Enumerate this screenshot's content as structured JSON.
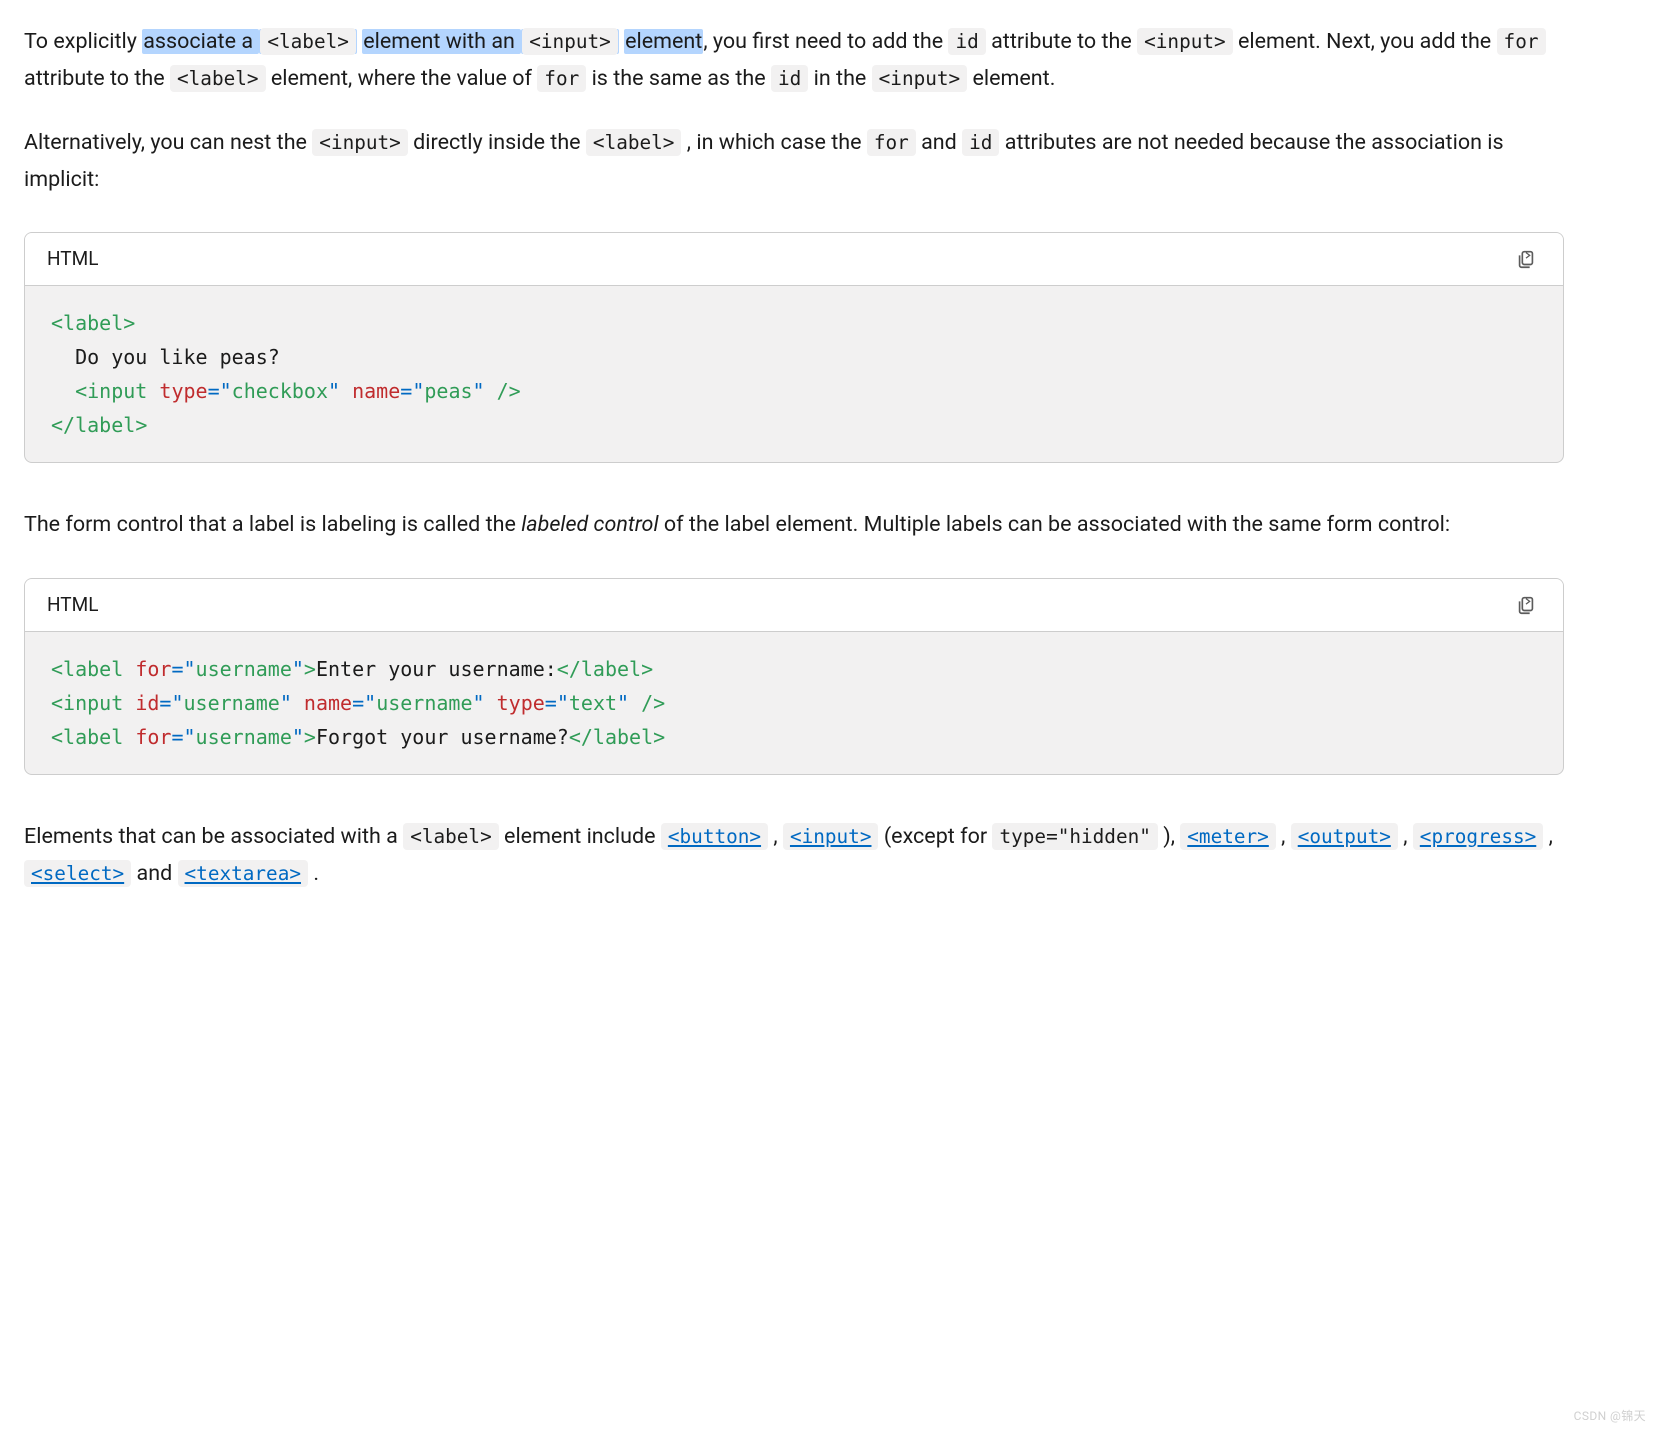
{
  "para1": {
    "t0": "To explicitly ",
    "hl1": "associate a ",
    "hl2_code": "<label>",
    "hl3": " element with an ",
    "hl4_code": "<input>",
    "hl5": " element",
    "t1": ", you first need to add the ",
    "c_id1": "id",
    "t2": " attribute to the ",
    "c_input1": "<input>",
    "t3": " element. Next, you add the ",
    "c_for1": "for",
    "t4": " attribute to the ",
    "c_label1": "<label>",
    "t5": " element, where the value of ",
    "c_for2": "for",
    "t6": " is the same as the ",
    "c_id2": "id",
    "t7": " in the ",
    "c_input2": "<input>",
    "t8": " element."
  },
  "para2": {
    "t0": "Alternatively, you can nest the ",
    "c_input": "<input>",
    "t1": " directly inside the ",
    "c_label": "<label>",
    "t2": " , in which case the ",
    "c_for": "for",
    "t3": " and ",
    "c_id": "id",
    "t4": " attributes are not needed because the association is implicit:"
  },
  "code1": {
    "lang": "HTML",
    "lines": {
      "l1_open": "<",
      "l1_tag": "label",
      "l1_close": ">",
      "l2_text": "  Do you like peas?",
      "l3_indent": "  ",
      "l3_open": "<",
      "l3_tag": "input",
      "l3_sp1": " ",
      "l3_attr1": "type",
      "l3_eq1": "=",
      "l3_q1a": "\"",
      "l3_val1": "checkbox",
      "l3_q1b": "\"",
      "l3_sp2": " ",
      "l3_attr2": "name",
      "l3_eq2": "=",
      "l3_q2a": "\"",
      "l3_val2": "peas",
      "l3_q2b": "\"",
      "l3_close": " />",
      "l4_open": "</",
      "l4_tag": "label",
      "l4_close": ">"
    }
  },
  "para3": {
    "t0": "The form control that a label is labeling is called the ",
    "em": "labeled control",
    "t1": " of the label element. Multiple labels can be associated with the same form control:"
  },
  "code2": {
    "lang": "HTML",
    "lines": {
      "a_open": "<",
      "a_tag": "label",
      "a_sp": " ",
      "a_attr": "for",
      "a_eq": "=",
      "a_qa": "\"",
      "a_val": "username",
      "a_qb": "\"",
      "a_close": ">",
      "a_text": "Enter your username:",
      "a_copen": "</",
      "a_ctag": "label",
      "a_cclose": ">",
      "b_open": "<",
      "b_tag": "input",
      "b_sp1": " ",
      "b_attr1": "id",
      "b_eq1": "=",
      "b_q1a": "\"",
      "b_val1": "username",
      "b_q1b": "\"",
      "b_sp2": " ",
      "b_attr2": "name",
      "b_eq2": "=",
      "b_q2a": "\"",
      "b_val2": "username",
      "b_q2b": "\"",
      "b_sp3": " ",
      "b_attr3": "type",
      "b_eq3": "=",
      "b_q3a": "\"",
      "b_val3": "text",
      "b_q3b": "\"",
      "b_close": " />",
      "c_open": "<",
      "c_tag": "label",
      "c_sp": " ",
      "c_attr": "for",
      "c_eq": "=",
      "c_qa": "\"",
      "c_val": "username",
      "c_qb": "\"",
      "c_close": ">",
      "c_text": "Forgot your username?",
      "c_copen": "</",
      "c_ctag": "label",
      "c_cclose": ">"
    }
  },
  "para4": {
    "t0": "Elements that can be associated with a ",
    "c_label": "<label>",
    "t1": " element include ",
    "link_button": "<button>",
    "sep1": " , ",
    "link_input": "<input>",
    "t2": " (except for ",
    "c_hidden": "type=\"hidden\"",
    "t3": " ), ",
    "link_meter": "<meter>",
    "sep2": " , ",
    "link_output": "<output>",
    "sep3": " , ",
    "link_progress": "<progress>",
    "sep4": " , ",
    "link_select": "<select>",
    "t4": " and ",
    "link_textarea": "<textarea>",
    "t5": " ."
  },
  "watermark": "CSDN @锦天"
}
